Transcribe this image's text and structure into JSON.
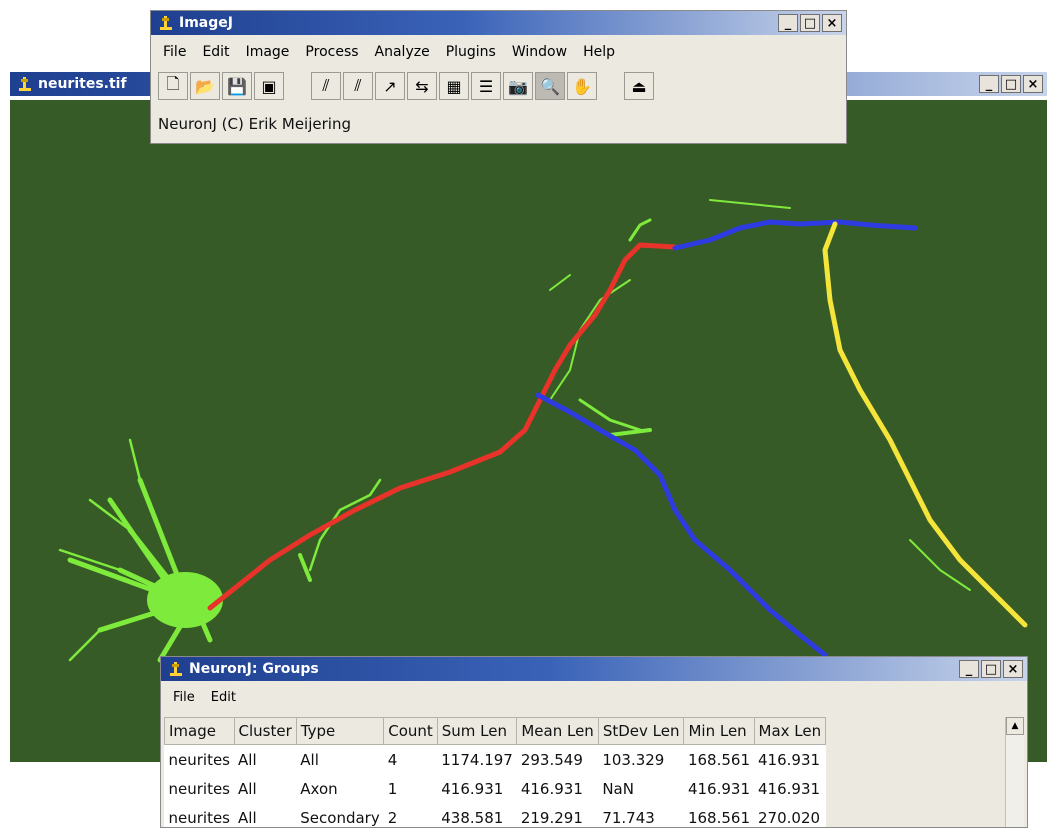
{
  "image_window": {
    "title": "neurites.tif"
  },
  "imagej_window": {
    "title": "ImageJ",
    "menu": [
      "File",
      "Edit",
      "Image",
      "Process",
      "Analyze",
      "Plugins",
      "Window",
      "Help"
    ],
    "status": "NeuronJ (C) Erik Meijering",
    "toolbar": [
      {
        "name": "new-icon",
        "glyph": "🗋"
      },
      {
        "name": "open-icon",
        "glyph": "📂"
      },
      {
        "name": "save-icon",
        "glyph": "💾"
      },
      {
        "name": "export-icon",
        "glyph": "▣"
      },
      {
        "name": "add-tracing-icon",
        "glyph": "⫽"
      },
      {
        "name": "delete-tracing-icon",
        "glyph": "⫽"
      },
      {
        "name": "move-vertices-icon",
        "glyph": "↗"
      },
      {
        "name": "measure-tracings-icon",
        "glyph": "⇆"
      },
      {
        "name": "label-tracings-icon",
        "glyph": "▦"
      },
      {
        "name": "list-tracings-icon",
        "glyph": "☰"
      },
      {
        "name": "snapshot-icon",
        "glyph": "📷"
      },
      {
        "name": "zoom-icon",
        "glyph": "🔍"
      },
      {
        "name": "hand-icon",
        "glyph": "✋"
      },
      {
        "name": "quit-icon",
        "glyph": "⏏"
      }
    ]
  },
  "groups_window": {
    "title": "NeuronJ: Groups",
    "menu": [
      "File",
      "Edit"
    ],
    "columns": [
      "Image",
      "Cluster",
      "Type",
      "Count",
      "Sum Len",
      "Mean Len",
      "StDev Len",
      "Min Len",
      "Max Len"
    ],
    "rows": [
      [
        "neurites",
        "All",
        "All",
        "4",
        "1174.197",
        "293.549",
        "103.329",
        "168.561",
        "416.931"
      ],
      [
        "neurites",
        "All",
        "Axon",
        "1",
        "416.931",
        "416.931",
        "NaN",
        "416.931",
        "416.931"
      ],
      [
        "neurites",
        "All",
        "Secondary",
        "2",
        "438.581",
        "219.291",
        "71.743",
        "168.561",
        "270.020"
      ]
    ]
  },
  "window_buttons": {
    "minimize": "_",
    "maximize": "□",
    "close": "×"
  },
  "tracing_colors": {
    "axon": "#e8332a",
    "secondary": "#2e3be0",
    "tertiary": "#f5e43a"
  },
  "background_color": "#375b27",
  "neurite_color": "#7eea3c"
}
